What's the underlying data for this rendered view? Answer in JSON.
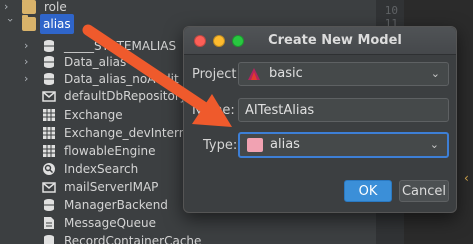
{
  "tree": {
    "items": [
      {
        "label": "role",
        "kind": "folder"
      },
      {
        "label": "alias",
        "kind": "folder",
        "selected": true
      },
      {
        "label": "_____SYSTEMALIAS",
        "kind": "db"
      },
      {
        "label": "Data_alias",
        "kind": "db"
      },
      {
        "label": "Data_alias_noAudit",
        "kind": "db"
      },
      {
        "label": "defaultDbRepository",
        "kind": "mail"
      },
      {
        "label": "Exchange",
        "kind": "table"
      },
      {
        "label": "Exchange_devIntern",
        "kind": "table"
      },
      {
        "label": "flowableEngine",
        "kind": "table"
      },
      {
        "label": "IndexSearch",
        "kind": "search"
      },
      {
        "label": "mailServerIMAP",
        "kind": "mail"
      },
      {
        "label": "ManagerBackend",
        "kind": "db"
      },
      {
        "label": "MessageQueue",
        "kind": "file"
      },
      {
        "label": "RecordContainerCache",
        "kind": "db"
      }
    ]
  },
  "gutter": {
    "lines": [
      "10",
      "11"
    ]
  },
  "dialog": {
    "title": "Create New Model",
    "project_label": "Project:",
    "project_value": "basic",
    "name_label": "Name:",
    "name_value": "AITestAlias",
    "type_label": "Type:",
    "type_value": "alias",
    "ok_label": "OK",
    "cancel_label": "Cancel"
  },
  "colors": {
    "accent": "#3b8fd8",
    "selection": "#2f65ca",
    "arrow": "#ef5a2c",
    "traffic_close": "#fd5f57",
    "traffic_min": "#febb2e",
    "traffic_max": "#28c840",
    "alias_swatch": "#f1a2b2"
  }
}
